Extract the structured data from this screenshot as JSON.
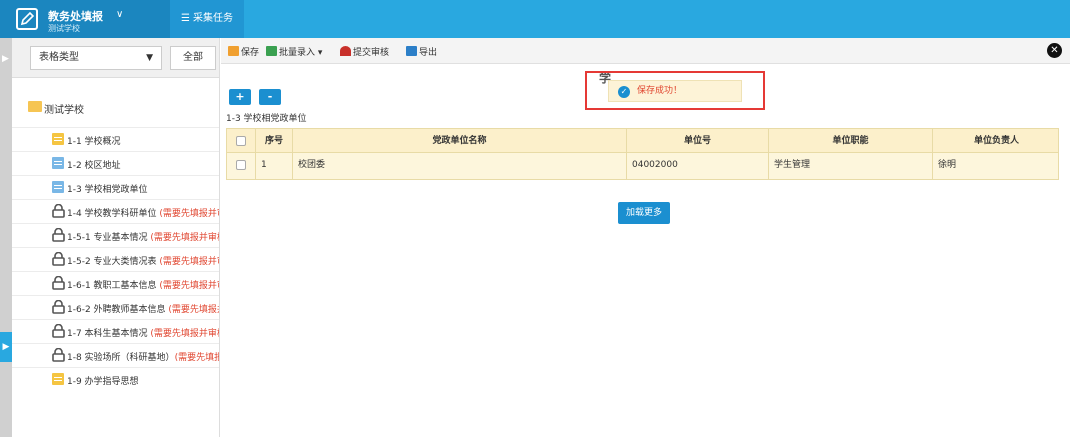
{
  "app": {
    "title": "教务处填报",
    "subtitle": "测试学校",
    "caret": "∨",
    "tasks_label": "采集任务",
    "tasks_icon": "list-icon"
  },
  "sidebar": {
    "type_select": "表格类型",
    "all_button": "全部",
    "root_label": "测试学校",
    "items": [
      {
        "label": "1-1 学校概况",
        "note": "",
        "icon": "doc-icon",
        "color": "#f5c542"
      },
      {
        "label": "1-2 校区地址",
        "note": "",
        "icon": "doc-icon",
        "color": "#79b7e6"
      },
      {
        "label": "1-3 学校相党政单位",
        "note": "",
        "icon": "doc-icon",
        "color": "#79b7e6"
      },
      {
        "label": "1-4 学校教学科研单位 ",
        "note": "(需要先填报并审核",
        "icon": "lock-icon"
      },
      {
        "label": "1-5-1 专业基本情况 ",
        "note": "(需要先填报并审核",
        "icon": "lock-icon"
      },
      {
        "label": "1-5-2 专业大类情况表 ",
        "note": "(需要先填报并审核",
        "icon": "lock-icon"
      },
      {
        "label": "1-6-1 教职工基本信息 ",
        "note": "(需要先填报并审核",
        "icon": "lock-icon"
      },
      {
        "label": "1-6-2 外聘教师基本信息 ",
        "note": "(需要先填报并审",
        "icon": "lock-icon"
      },
      {
        "label": "1-7 本科生基本情况 ",
        "note": "(需要先填报并审核",
        "icon": "lock-icon"
      },
      {
        "label": "1-8 实验场所（科研基地）",
        "note": "(需要先填报并",
        "icon": "lock-icon"
      },
      {
        "label": "1-9 办学指导思想",
        "note": "",
        "icon": "doc-icon",
        "color": "#f5c542"
      }
    ]
  },
  "toolbar": {
    "save": "保存",
    "batch_import": "批量录入",
    "submit_review": "提交审核",
    "export": "导出"
  },
  "table": {
    "caption": "1-3 学校相党政单位",
    "add_label": "+",
    "remove_label": "-",
    "columns": [
      "序号",
      "党政单位名称",
      "单位号",
      "单位职能",
      "单位负责人"
    ],
    "rows": [
      {
        "index": "1",
        "name": "校团委",
        "code": "04002000",
        "function": "学生管理",
        "leader": "徐明"
      }
    ],
    "load_more": "加载更多"
  },
  "popup": {
    "title": "学",
    "toast_message": "保存成功！"
  },
  "colors": {
    "topbar": "#29a8e0",
    "accent": "#1b8fd0",
    "highlight_border": "#e53935",
    "table_header_bg": "#fcf0cb"
  }
}
